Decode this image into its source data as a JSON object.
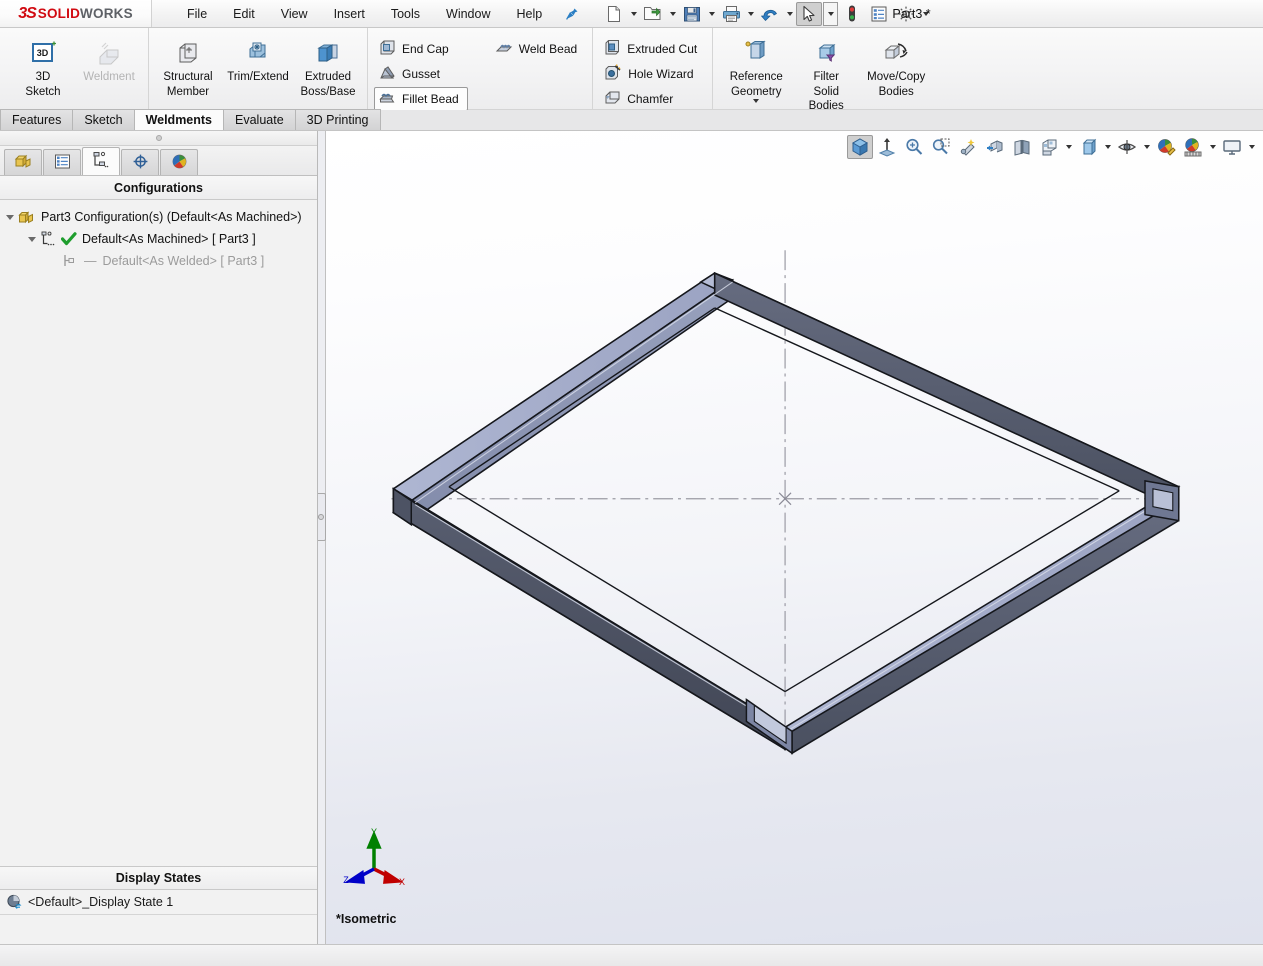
{
  "app": {
    "brand_ds": "3S",
    "brand_solid": "SOLID",
    "brand_works": "WORKS",
    "document_title": "Part3 *",
    "accent_red": "#d10a11",
    "accent_blue": "#1f6fbf"
  },
  "menu": {
    "items": [
      {
        "label": "File"
      },
      {
        "label": "Edit"
      },
      {
        "label": "View"
      },
      {
        "label": "Insert"
      },
      {
        "label": "Tools"
      },
      {
        "label": "Window"
      },
      {
        "label": "Help"
      }
    ],
    "pin_icon": "pushpin-icon"
  },
  "quick_access": {
    "buttons": [
      {
        "name": "new-document-button",
        "icon": "new-document-icon",
        "has_dropdown": true
      },
      {
        "name": "open-document-button",
        "icon": "open-folder-icon",
        "has_dropdown": true
      },
      {
        "name": "save-button",
        "icon": "floppy-disk-icon",
        "has_dropdown": true
      },
      {
        "name": "print-button",
        "icon": "printer-icon",
        "has_dropdown": true
      },
      {
        "name": "undo-button",
        "icon": "undo-arrow-icon",
        "has_dropdown": true
      },
      {
        "name": "select-button",
        "icon": "cursor-arrow-icon",
        "has_dropdown": true,
        "selected": true
      },
      {
        "name": "rebuild-button",
        "icon": "traffic-light-icon",
        "has_dropdown": false
      },
      {
        "name": "file-properties-button",
        "icon": "properties-list-icon",
        "has_dropdown": false
      },
      {
        "name": "options-button",
        "icon": "gear-icon",
        "has_dropdown": true
      }
    ]
  },
  "ribbon": {
    "groups": [
      {
        "name": "sketch-group",
        "large_buttons": [
          {
            "name": "3d-sketch-button",
            "icon": "3d-sketch-icon",
            "label": "3D\nSketch",
            "label_l1": "3D",
            "label_l2": "Sketch",
            "disabled": false
          },
          {
            "name": "weldment-button",
            "icon": "weldment-icon",
            "label_l1": "Weldment",
            "label_l2": "",
            "disabled": true
          }
        ]
      },
      {
        "name": "structure-group",
        "large_buttons": [
          {
            "name": "structural-member-button",
            "icon": "structural-member-icon",
            "label_l1": "Structural",
            "label_l2": "Member",
            "disabled": false
          },
          {
            "name": "trim-extend-button",
            "icon": "trim-extend-icon",
            "label_l1": "Trim/Extend",
            "label_l2": "",
            "disabled": false
          },
          {
            "name": "extruded-boss-base-button",
            "icon": "extruded-boss-icon",
            "label_l1": "Extruded",
            "label_l2": "Boss/Base",
            "disabled": false
          }
        ]
      },
      {
        "name": "weld-features-group",
        "small_columns": [
          [
            {
              "name": "end-cap-button",
              "icon": "end-cap-icon",
              "label": "End Cap",
              "framed": false
            },
            {
              "name": "gusset-button",
              "icon": "gusset-icon",
              "label": "Gusset",
              "framed": false
            },
            {
              "name": "fillet-bead-button",
              "icon": "fillet-bead-icon",
              "label": "Fillet Bead",
              "framed": true
            }
          ],
          [
            {
              "name": "weld-bead-button",
              "icon": "weld-bead-icon",
              "label": "Weld Bead",
              "framed": false
            }
          ]
        ]
      },
      {
        "name": "cut-features-group",
        "small_columns": [
          [
            {
              "name": "extruded-cut-button",
              "icon": "extruded-cut-icon",
              "label": "Extruded Cut",
              "framed": false
            },
            {
              "name": "hole-wizard-button",
              "icon": "hole-wizard-icon",
              "label": "Hole Wizard",
              "framed": false
            },
            {
              "name": "chamfer-button",
              "icon": "chamfer-icon",
              "label": "Chamfer",
              "framed": false
            }
          ]
        ]
      },
      {
        "name": "geometry-group",
        "large_buttons": [
          {
            "name": "reference-geometry-button",
            "icon": "reference-plane-icon",
            "label_l1": "Reference",
            "label_l2": "Geometry",
            "has_dropdown": true,
            "disabled": false
          },
          {
            "name": "filter-solid-bodies-button",
            "icon": "filter-solid-bodies-icon",
            "label_l1": "Filter",
            "label_l2": "Solid",
            "label_l3": "Bodies",
            "disabled": false
          },
          {
            "name": "move-copy-bodies-button",
            "icon": "move-copy-bodies-icon",
            "label_l1": "Move/Copy",
            "label_l2": "Bodies",
            "disabled": false
          }
        ]
      }
    ]
  },
  "command_tabs": {
    "items": [
      {
        "name": "tab-features",
        "label": "Features",
        "active": false
      },
      {
        "name": "tab-sketch",
        "label": "Sketch",
        "active": false
      },
      {
        "name": "tab-weldments",
        "label": "Weldments",
        "active": true
      },
      {
        "name": "tab-evaluate",
        "label": "Evaluate",
        "active": false
      },
      {
        "name": "tab-3d-printing",
        "label": "3D Printing",
        "active": false
      }
    ]
  },
  "left_panel": {
    "tabs": [
      {
        "name": "feature-manager-tab",
        "icon": "feature-tree-icon",
        "active": false
      },
      {
        "name": "property-manager-tab",
        "icon": "property-list-icon",
        "active": false
      },
      {
        "name": "configuration-manager-tab",
        "icon": "configuration-icon",
        "active": true
      },
      {
        "name": "dimxpert-manager-tab",
        "icon": "dimxpert-target-icon",
        "active": false
      },
      {
        "name": "display-manager-tab",
        "icon": "display-sphere-icon",
        "active": false
      }
    ],
    "section_title": "Configurations",
    "tree": [
      {
        "name": "tree-root-configurations",
        "icon": "configuration-folder-icon",
        "label": "Part3 Configuration(s)  (Default<As Machined>)",
        "indent": 0,
        "expanded": true,
        "dim": false,
        "has_check": false
      },
      {
        "name": "tree-config-default-as-machined",
        "icon": "config-item-icon",
        "label": "Default<As Machined> [ Part3 ]",
        "indent": 1,
        "expanded": true,
        "dim": false,
        "has_check": true
      },
      {
        "name": "tree-config-default-as-welded",
        "icon": "derived-config-icon",
        "label": "Default<As Welded> [ Part3 ]",
        "indent": 2,
        "expanded": false,
        "dim": true,
        "has_check": false,
        "has_dash": true
      }
    ],
    "display_states": {
      "title": "Display States",
      "items": [
        {
          "name": "display-state-item",
          "icon": "display-state-icon",
          "label": "<Default>_Display State 1"
        }
      ]
    }
  },
  "viewport": {
    "toolbar": [
      {
        "name": "view-orientation-button",
        "icon": "isometric-cube-icon",
        "selected": true,
        "has_dropdown": false
      },
      {
        "name": "zoom-to-fit-button",
        "icon": "zoom-to-fit-icon",
        "selected": false,
        "has_dropdown": false
      },
      {
        "name": "zoom-to-area-button",
        "icon": "magnifier-icon",
        "selected": false,
        "has_dropdown": false
      },
      {
        "name": "zoom-window-button",
        "icon": "magnifier-box-icon",
        "selected": false,
        "has_dropdown": false
      },
      {
        "name": "previous-view-button",
        "icon": "flashlight-star-icon",
        "selected": false,
        "has_dropdown": false
      },
      {
        "name": "section-view-button",
        "icon": "section-arrow-icon",
        "selected": false,
        "has_dropdown": false
      },
      {
        "name": "mirror-view-button",
        "icon": "mirror-panel-icon",
        "selected": false,
        "has_dropdown": false
      },
      {
        "name": "view-orientation-menu-button",
        "icon": "view-orientation-icon",
        "selected": false,
        "has_dropdown": true
      },
      {
        "name": "display-style-button",
        "icon": "display-style-cube-icon",
        "selected": false,
        "has_dropdown": true
      },
      {
        "name": "hide-show-items-button",
        "icon": "eye-icon",
        "selected": false,
        "has_dropdown": true
      },
      {
        "name": "edit-appearance-button",
        "icon": "appearance-sphere-pencil-icon",
        "selected": false,
        "has_dropdown": false
      },
      {
        "name": "apply-scene-button",
        "icon": "scene-sphere-icon",
        "selected": false,
        "has_dropdown": true
      },
      {
        "name": "view-settings-button",
        "icon": "monitor-icon",
        "selected": false,
        "has_dropdown": true
      }
    ],
    "view_label": "*Isometric",
    "triad": {
      "x_label": "X",
      "y_label": "Y",
      "z_label": "Z",
      "x_color": "#c00000",
      "y_color": "#008000",
      "z_color": "#0000c8"
    },
    "model": {
      "name": "weldment-rectangular-frame",
      "description": "Square weldment frame of rectangular tube members shown in isometric orientation",
      "face_top_color": "#a9b1cd",
      "face_side_color": "#4d5261",
      "face_inner_color": "#8d96b4",
      "edge_color": "#15171c",
      "centerline_color": "#909098"
    }
  }
}
